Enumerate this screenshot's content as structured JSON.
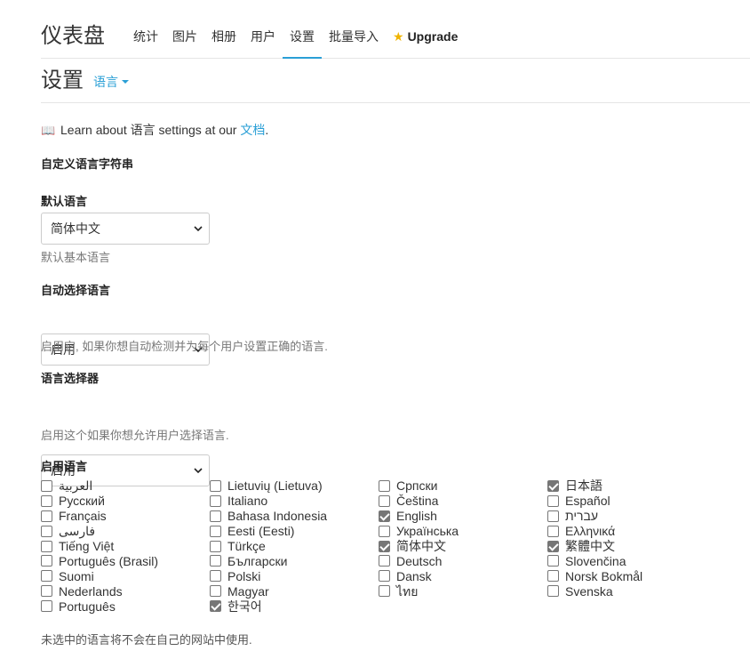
{
  "header": {
    "brand": "仪表盘",
    "nav": [
      {
        "label": "统计",
        "active": false
      },
      {
        "label": "图片",
        "active": false
      },
      {
        "label": "相册",
        "active": false
      },
      {
        "label": "用户",
        "active": false
      },
      {
        "label": "设置",
        "active": true
      },
      {
        "label": "批量导入",
        "active": false
      }
    ],
    "upgrade_label": "Upgrade"
  },
  "titlebar": {
    "title": "设置",
    "section_dropdown": "语言"
  },
  "learn": {
    "prefix": "Learn about ",
    "topic": "语言",
    "middle": " settings at our ",
    "link": "文档",
    "suffix": "."
  },
  "custom_strings_heading": "自定义语言字符串",
  "default_language": {
    "label": "默认语言",
    "value": "简体中文",
    "help": "默认基本语言"
  },
  "auto_language": {
    "label": "自动选择语言",
    "value": "启用",
    "help": "启用它, 如果你想自动检测并为每个用户设置正确的语言."
  },
  "language_selector": {
    "label": "语言选择器",
    "value": "启用",
    "help": "启用这个如果你想允许用户选择语言."
  },
  "enabled_languages": {
    "label": "启用语言",
    "columns": [
      [
        {
          "name": "العربية",
          "checked": false
        },
        {
          "name": "Русский",
          "checked": false
        },
        {
          "name": "Français",
          "checked": false
        },
        {
          "name": "فارسی",
          "checked": false
        },
        {
          "name": "Tiếng Việt",
          "checked": false
        },
        {
          "name": "Português (Brasil)",
          "checked": false
        },
        {
          "name": "Suomi",
          "checked": false
        },
        {
          "name": "Nederlands",
          "checked": false
        },
        {
          "name": "Português",
          "checked": false
        }
      ],
      [
        {
          "name": "Lietuvių (Lietuva)",
          "checked": false
        },
        {
          "name": "Italiano",
          "checked": false
        },
        {
          "name": "Bahasa Indonesia",
          "checked": false
        },
        {
          "name": "Eesti (Eesti)",
          "checked": false
        },
        {
          "name": "Türkçe",
          "checked": false
        },
        {
          "name": "Български",
          "checked": false
        },
        {
          "name": "Polski",
          "checked": false
        },
        {
          "name": "Magyar",
          "checked": false
        },
        {
          "name": "한국어",
          "checked": true
        }
      ],
      [
        {
          "name": "Српски",
          "checked": false
        },
        {
          "name": "Čeština",
          "checked": false
        },
        {
          "name": "English",
          "checked": true
        },
        {
          "name": "Українська",
          "checked": false
        },
        {
          "name": "简体中文",
          "checked": true
        },
        {
          "name": "Deutsch",
          "checked": false
        },
        {
          "name": "Dansk",
          "checked": false
        },
        {
          "name": "ไทย",
          "checked": false
        }
      ],
      [
        {
          "name": "日本語",
          "checked": true
        },
        {
          "name": "Español",
          "checked": false
        },
        {
          "name": "עברית",
          "checked": false
        },
        {
          "name": "Ελληνικά",
          "checked": false
        },
        {
          "name": "繁體中文",
          "checked": true
        },
        {
          "name": "Slovenčina",
          "checked": false
        },
        {
          "name": "Norsk Bokmål",
          "checked": false
        },
        {
          "name": "Svenska",
          "checked": false
        }
      ]
    ]
  },
  "footer_note": "未选中的语言将不会在自己的网站中使用.",
  "colors": {
    "accent": "#2a9fd6",
    "star": "#f0b400",
    "checkbox_checked": "#767676"
  },
  "icons": {
    "upgrade": "star-icon",
    "docs": "book-icon",
    "dropdown": "caret-down-icon",
    "select": "chevron-down-icon"
  }
}
